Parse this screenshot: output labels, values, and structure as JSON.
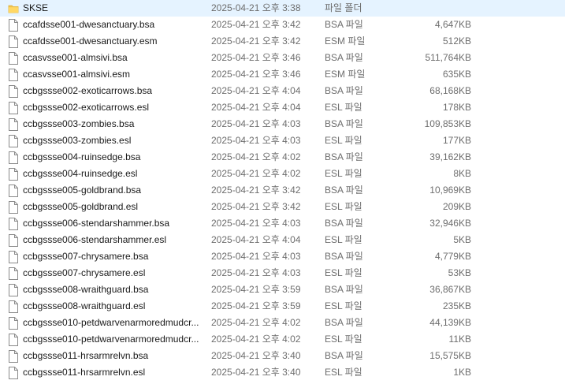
{
  "files": [
    {
      "icon": "folder-icon",
      "name": "SKSE",
      "date": "2025-04-21 오후 3:38",
      "type": "파일 폴더",
      "size": ""
    },
    {
      "icon": "file-icon",
      "name": "ccafdsse001-dwesanctuary.bsa",
      "date": "2025-04-21 오후 3:42",
      "type": "BSA 파일",
      "size": "4,647KB"
    },
    {
      "icon": "file-icon",
      "name": "ccafdsse001-dwesanctuary.esm",
      "date": "2025-04-21 오후 3:42",
      "type": "ESM 파일",
      "size": "512KB"
    },
    {
      "icon": "file-icon",
      "name": "ccasvsse001-almsivi.bsa",
      "date": "2025-04-21 오후 3:46",
      "type": "BSA 파일",
      "size": "511,764KB"
    },
    {
      "icon": "file-icon",
      "name": "ccasvsse001-almsivi.esm",
      "date": "2025-04-21 오후 3:46",
      "type": "ESM 파일",
      "size": "635KB"
    },
    {
      "icon": "file-icon",
      "name": "ccbgssse002-exoticarrows.bsa",
      "date": "2025-04-21 오후 4:04",
      "type": "BSA 파일",
      "size": "68,168KB"
    },
    {
      "icon": "file-icon",
      "name": "ccbgssse002-exoticarrows.esl",
      "date": "2025-04-21 오후 4:04",
      "type": "ESL 파일",
      "size": "178KB"
    },
    {
      "icon": "file-icon",
      "name": "ccbgssse003-zombies.bsa",
      "date": "2025-04-21 오후 4:03",
      "type": "BSA 파일",
      "size": "109,853KB"
    },
    {
      "icon": "file-icon",
      "name": "ccbgssse003-zombies.esl",
      "date": "2025-04-21 오후 4:03",
      "type": "ESL 파일",
      "size": "177KB"
    },
    {
      "icon": "file-icon",
      "name": "ccbgssse004-ruinsedge.bsa",
      "date": "2025-04-21 오후 4:02",
      "type": "BSA 파일",
      "size": "39,162KB"
    },
    {
      "icon": "file-icon",
      "name": "ccbgssse004-ruinsedge.esl",
      "date": "2025-04-21 오후 4:02",
      "type": "ESL 파일",
      "size": "8KB"
    },
    {
      "icon": "file-icon",
      "name": "ccbgssse005-goldbrand.bsa",
      "date": "2025-04-21 오후 3:42",
      "type": "BSA 파일",
      "size": "10,969KB"
    },
    {
      "icon": "file-icon",
      "name": "ccbgssse005-goldbrand.esl",
      "date": "2025-04-21 오후 3:42",
      "type": "ESL 파일",
      "size": "209KB"
    },
    {
      "icon": "file-icon",
      "name": "ccbgssse006-stendarshammer.bsa",
      "date": "2025-04-21 오후 4:03",
      "type": "BSA 파일",
      "size": "32,946KB"
    },
    {
      "icon": "file-icon",
      "name": "ccbgssse006-stendarshammer.esl",
      "date": "2025-04-21 오후 4:04",
      "type": "ESL 파일",
      "size": "5KB"
    },
    {
      "icon": "file-icon",
      "name": "ccbgssse007-chrysamere.bsa",
      "date": "2025-04-21 오후 4:03",
      "type": "BSA 파일",
      "size": "4,779KB"
    },
    {
      "icon": "file-icon",
      "name": "ccbgssse007-chrysamere.esl",
      "date": "2025-04-21 오후 4:03",
      "type": "ESL 파일",
      "size": "53KB"
    },
    {
      "icon": "file-icon",
      "name": "ccbgssse008-wraithguard.bsa",
      "date": "2025-04-21 오후 3:59",
      "type": "BSA 파일",
      "size": "36,867KB"
    },
    {
      "icon": "file-icon",
      "name": "ccbgssse008-wraithguard.esl",
      "date": "2025-04-21 오후 3:59",
      "type": "ESL 파일",
      "size": "235KB"
    },
    {
      "icon": "file-icon",
      "name": "ccbgssse010-petdwarvenarmoredmudcr...",
      "date": "2025-04-21 오후 4:02",
      "type": "BSA 파일",
      "size": "44,139KB"
    },
    {
      "icon": "file-icon",
      "name": "ccbgssse010-petdwarvenarmoredmudcr...",
      "date": "2025-04-21 오후 4:02",
      "type": "ESL 파일",
      "size": "11KB"
    },
    {
      "icon": "file-icon",
      "name": "ccbgssse011-hrsarmrelvn.bsa",
      "date": "2025-04-21 오후 3:40",
      "type": "BSA 파일",
      "size": "15,575KB"
    },
    {
      "icon": "file-icon",
      "name": "ccbgssse011-hrsarmrelvn.esl",
      "date": "2025-04-21 오후 3:40",
      "type": "ESL 파일",
      "size": "1KB"
    }
  ]
}
